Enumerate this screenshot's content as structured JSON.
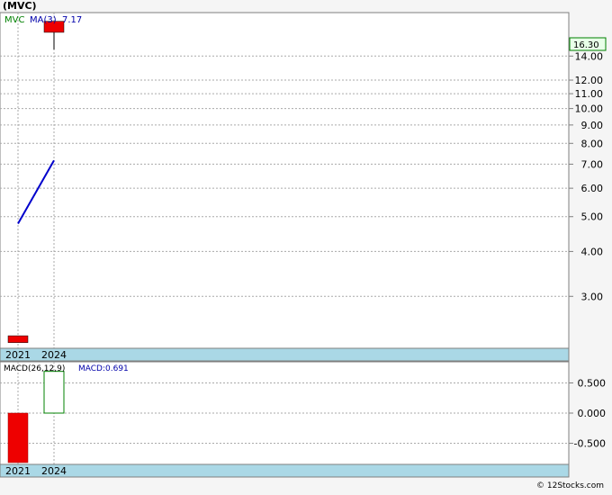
{
  "title": "(MVC)",
  "footer": "© 12Stocks.com",
  "colors": {
    "down_candle": "#ee0000",
    "up_candle_outline": "#008000",
    "ma_line": "#0000cc",
    "legend_symbol": "#008000",
    "legend_ma": "#0000aa",
    "axis_band": "#aad8e6",
    "grid": "#aaaaaa"
  },
  "chart_data": [
    {
      "type": "candlestick",
      "panel": "price",
      "scale": "log",
      "legend": {
        "symbol": "MVC",
        "ma_label": "MA(3)",
        "ma_value": "7.17"
      },
      "x_categories": [
        "2021",
        "2024"
      ],
      "y_ticks": [
        "3.00",
        "4.00",
        "5.00",
        "6.00",
        "7.00",
        "8.00",
        "9.00",
        "10.00",
        "11.00",
        "12.00",
        "14.00"
      ],
      "ylim": [
        2.15,
        18.5
      ],
      "last_price_label": "16.30",
      "candles": [
        {
          "x": "2021",
          "open": 2.33,
          "close": 2.23,
          "high": 2.33,
          "low": 2.23,
          "direction": "down"
        },
        {
          "x": "2024",
          "open": 17.5,
          "close": 16.3,
          "high": 17.5,
          "low": 14.6,
          "direction": "down"
        }
      ],
      "moving_average": {
        "name": "MA(3)",
        "points": [
          {
            "x": "2021",
            "y": 4.78
          },
          {
            "x": "2024",
            "y": 7.17
          }
        ]
      },
      "grid": true
    },
    {
      "type": "bar",
      "panel": "macd",
      "legend": {
        "name": "MACD(26,12,9)",
        "value_label": "MACD:0.691"
      },
      "x_categories": [
        "2021",
        "2024"
      ],
      "y_ticks": [
        "0.500",
        "0.000",
        "-0.500"
      ],
      "y_tick_values": [
        0.5,
        0.0,
        -0.5
      ],
      "ylim": [
        -0.85,
        0.85
      ],
      "bars": [
        {
          "x": "2021",
          "value": -0.82,
          "style": "filled-red"
        },
        {
          "x": "2024",
          "value": 0.691,
          "style": "outline-green"
        }
      ],
      "grid": true
    }
  ]
}
